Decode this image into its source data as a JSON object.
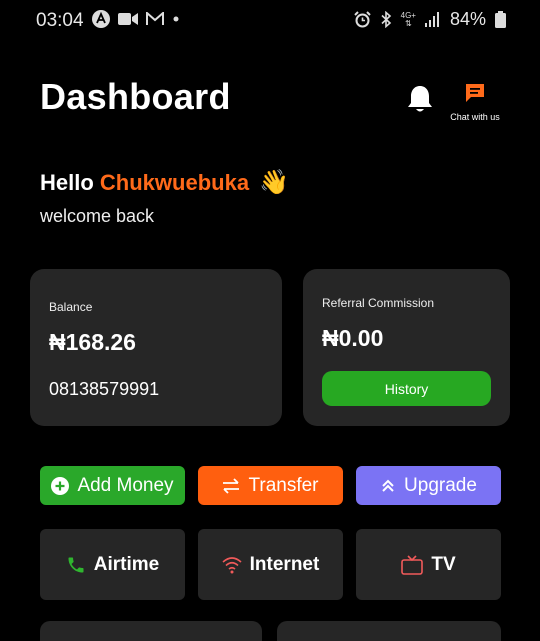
{
  "status_bar": {
    "time": "03:04",
    "network": "4G+",
    "battery": "84%"
  },
  "header": {
    "title": "Dashboard",
    "chat_label": "Chat with us"
  },
  "greeting": {
    "hello": "Hello",
    "name": "Chukwuebuka",
    "emoji": "👋",
    "subtitle": "welcome back"
  },
  "balance_card": {
    "label": "Balance",
    "amount": "₦168.26",
    "phone": "08138579991"
  },
  "referral_card": {
    "label": "Referral Commission",
    "amount": "₦0.00",
    "button": "History"
  },
  "actions": [
    {
      "label": "Add Money",
      "icon": "plus-circle-icon",
      "color": "#2aa82a"
    },
    {
      "label": "Transfer",
      "icon": "swap-arrows-icon",
      "color": "#ff5f0f"
    },
    {
      "label": "Upgrade",
      "icon": "double-chevron-up-icon",
      "color": "#7b73f4"
    }
  ],
  "services": [
    {
      "label": "Airtime",
      "icon": "phone-icon",
      "color": "#2fb52f"
    },
    {
      "label": "Internet",
      "icon": "wifi-icon",
      "color": "#f05a5a"
    },
    {
      "label": "TV",
      "icon": "tv-icon",
      "color": "#f05a5a"
    }
  ],
  "colors": {
    "accent": "#ff6a1a",
    "card_bg": "#262626",
    "background": "#000000"
  }
}
